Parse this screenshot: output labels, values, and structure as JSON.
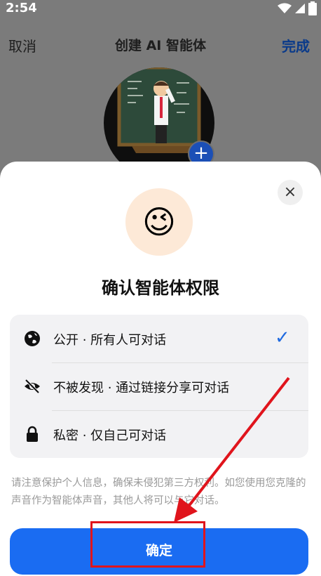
{
  "status_bar": {
    "time": "2:54"
  },
  "topbar": {
    "cancel_label": "取消",
    "title": "创建 AI 智能体",
    "done_label": "完成"
  },
  "avatar": {
    "add_label": "+"
  },
  "dialog": {
    "close_label": "×",
    "emoji": "😉",
    "heading": "确认智能体权限",
    "options": [
      {
        "label": "公开 · 所有人可对话",
        "icon": "globe-icon",
        "selected": true
      },
      {
        "label": "不被发现 · 通过链接分享可对话",
        "icon": "eye-slash-icon",
        "selected": false
      },
      {
        "label": "私密 · 仅自己可对话",
        "icon": "lock-icon",
        "selected": false
      }
    ],
    "check_mark": "✓",
    "notice": "请注意保护个人信息，确保未侵犯第三方权利。如您使用您克隆的声音作为智能体声音，其他人将可以与它对话。",
    "confirm_label": "确定"
  },
  "colors": {
    "primary": "#1a6cf2",
    "annotation": "#e0141c",
    "check": "#1f6ae0"
  }
}
